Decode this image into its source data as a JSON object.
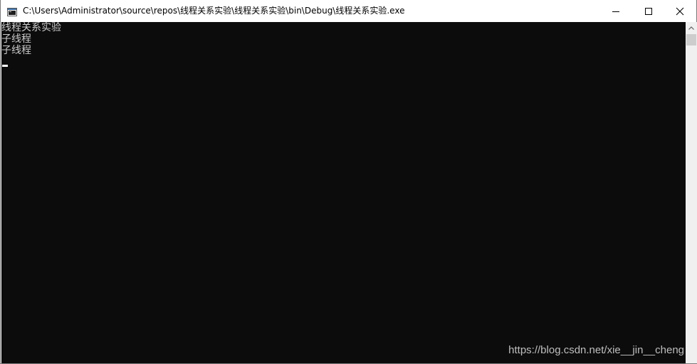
{
  "window": {
    "title": "C:\\Users\\Administrator\\source\\repos\\线程关系实验\\线程关系实验\\bin\\Debug\\线程关系实验.exe",
    "icon": "console-app-icon",
    "controls": {
      "minimize_icon": "minimize-icon",
      "maximize_icon": "maximize-icon",
      "close_icon": "close-icon"
    }
  },
  "console": {
    "background": "#0c0c0c",
    "text_color": "#cccccc",
    "lines": [
      "线程关系实验",
      "子线程",
      "子线程"
    ]
  },
  "watermark": "https://blog.csdn.net/xie__jin__cheng",
  "scrollbar": {
    "up_icon": "chevron-up-icon"
  }
}
